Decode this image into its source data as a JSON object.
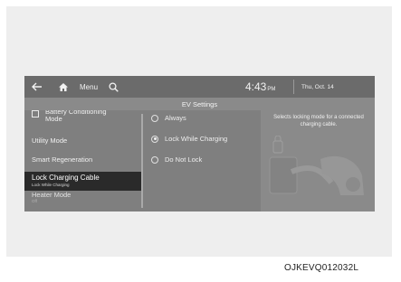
{
  "topbar": {
    "menu_label": "Menu",
    "time": "4:43",
    "ampm": "PM",
    "date": "Thu, Oct. 14"
  },
  "title": "EV Settings",
  "left_menu": {
    "items": [
      {
        "label": "Battery Conditioning Mode",
        "checkbox": true
      },
      {
        "label": "Utility Mode"
      },
      {
        "label": "Smart Regeneration"
      },
      {
        "label": "Lock Charging Cable",
        "sub": "Lock While Charging",
        "selected": true
      },
      {
        "label": "Heater Mode",
        "sub": "Off"
      }
    ]
  },
  "options": [
    {
      "label": "Always",
      "selected": false
    },
    {
      "label": "Lock While Charging",
      "selected": true
    },
    {
      "label": "Do Not Lock",
      "selected": false
    }
  ],
  "help_text": "Selects locking mode for a connected charging cable.",
  "figure_code": "OJKEVQ012032L",
  "icons": [
    "back-arrow-icon",
    "home-icon",
    "search-icon",
    "charging-cable-icon"
  ],
  "colors": {
    "screen": "#7f7f7f",
    "topbar": "#6b6b6b",
    "selected_item": "#2a2a2a"
  }
}
